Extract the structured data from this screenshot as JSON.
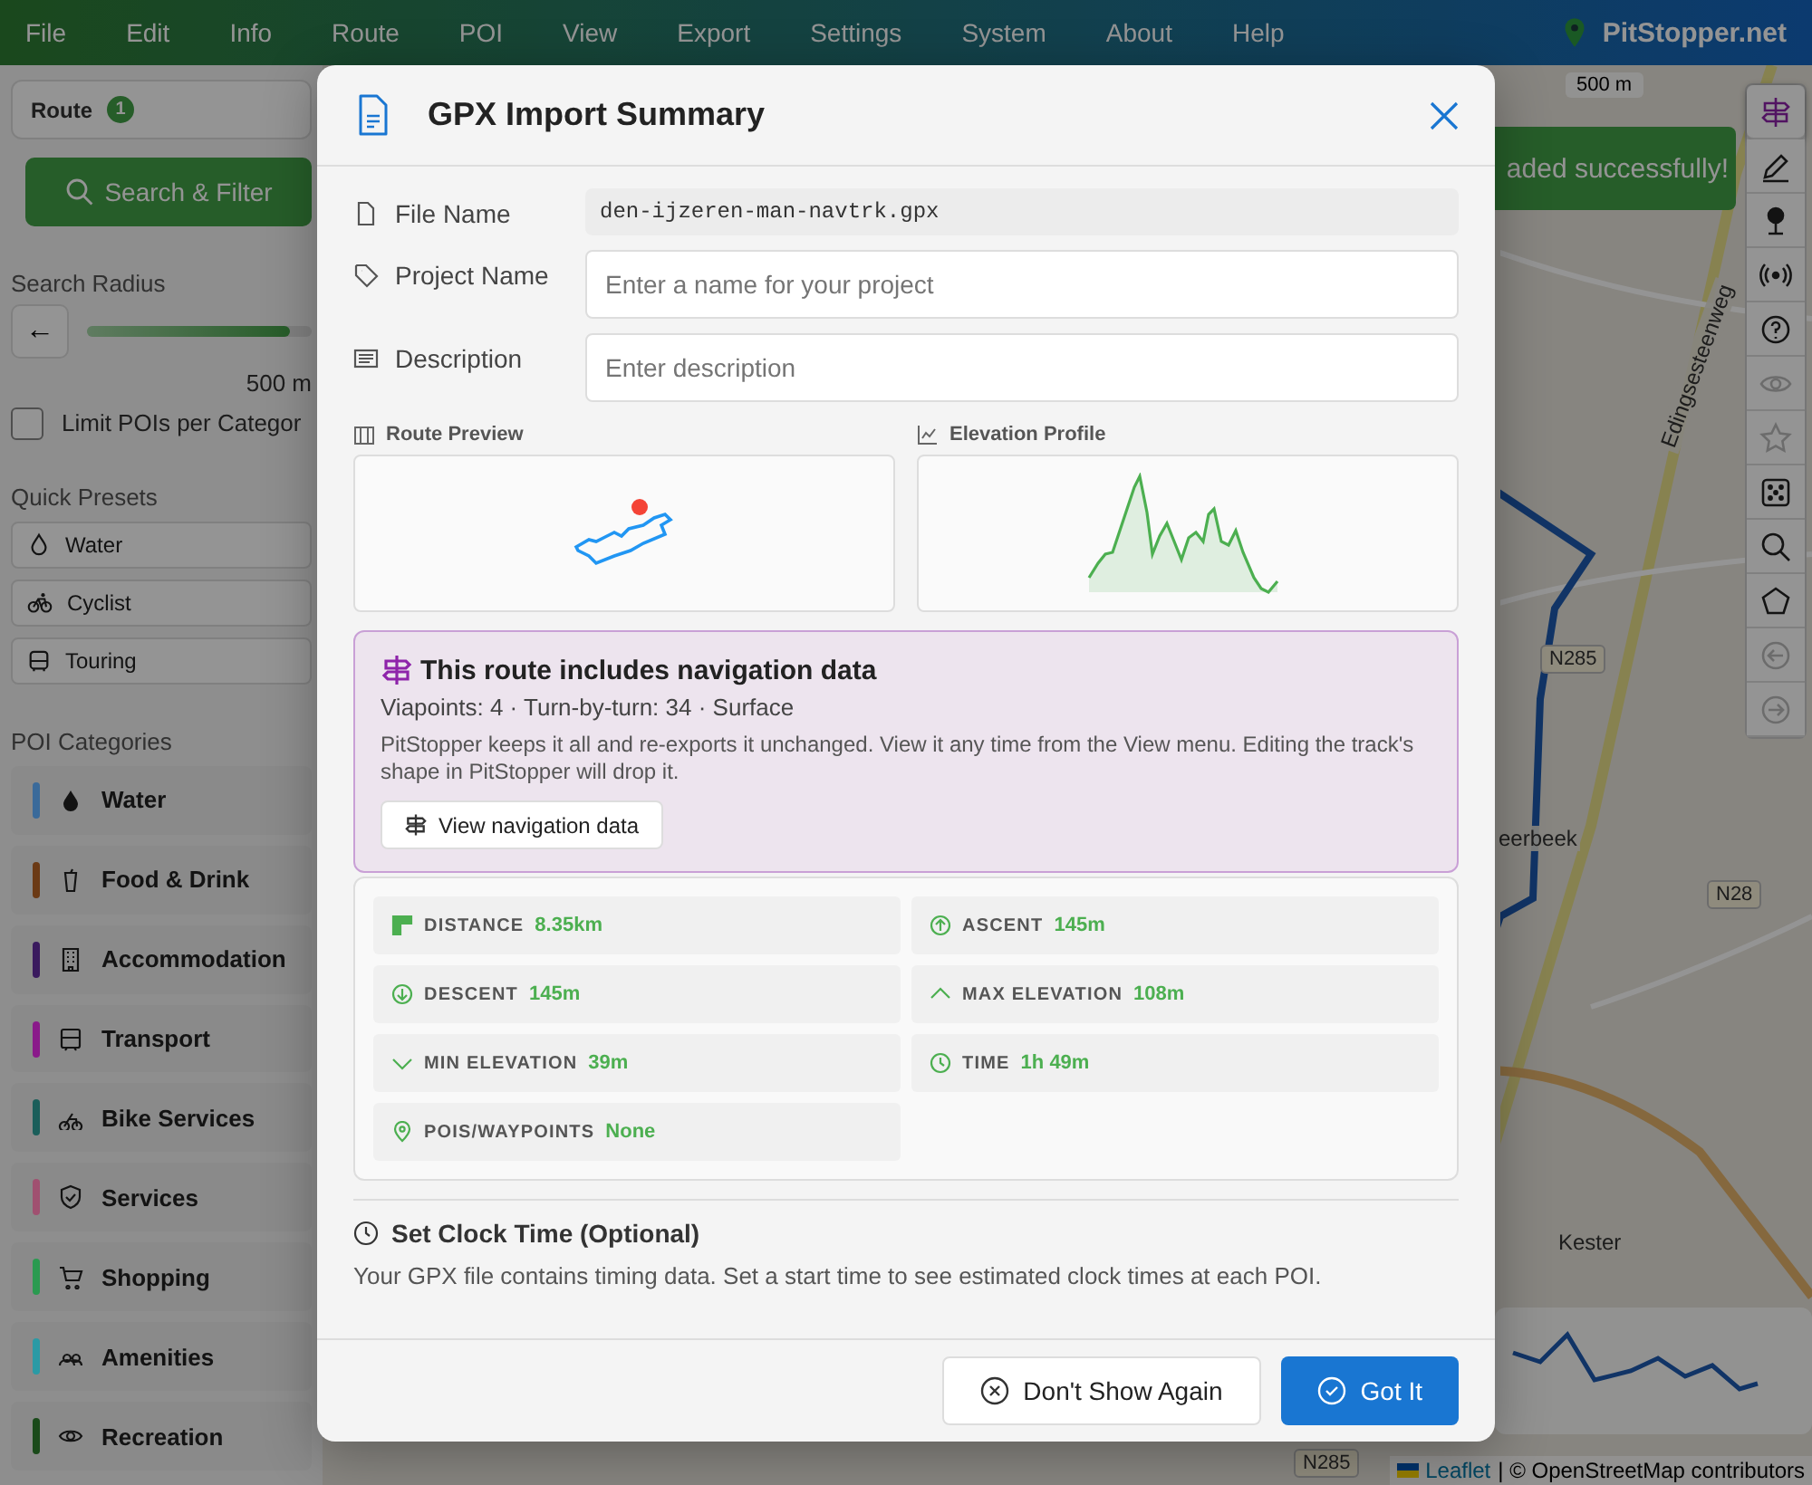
{
  "menu_bar": {
    "items": [
      "File",
      "Edit",
      "Info",
      "Route",
      "POI",
      "View",
      "Export",
      "Settings",
      "System",
      "About",
      "Help"
    ],
    "brand": "PitStopper.net"
  },
  "sidebar": {
    "route_tab": {
      "label": "Route",
      "badge": "1"
    },
    "search_button": "Search & Filter",
    "search_radius": {
      "label": "Search Radius",
      "back": "←",
      "level": 0.9,
      "reading": "500 m"
    },
    "limit_pois": {
      "label": "Limit POIs per Categor",
      "checked": false
    },
    "quick_presets": {
      "title": "Quick Presets",
      "items": [
        "Water",
        "Cyclist",
        "Touring"
      ]
    },
    "poi_categories": {
      "title": "POI Categories",
      "items": [
        {
          "label": "Water",
          "color": "#3a6a9a"
        },
        {
          "label": "Food & Drink",
          "color": "#6b3a15"
        },
        {
          "label": "Accommodation",
          "color": "#3a1a5e"
        },
        {
          "label": "Transport",
          "color": "#8a1a8a"
        },
        {
          "label": "Bike Services",
          "color": "#1a5e5a"
        },
        {
          "label": "Services",
          "color": "#a05070"
        },
        {
          "label": "Shopping",
          "color": "#2a9a50"
        },
        {
          "label": "Amenities",
          "color": "#2a9aa5"
        },
        {
          "label": "Recreation",
          "color": "#1a4a1a"
        }
      ]
    }
  },
  "map": {
    "scale": "500 m",
    "toast": "aded successfully!",
    "labels": [
      "Edingsesteenweg",
      "N285",
      "eerbeek",
      "N28",
      "Kester",
      "N285"
    ],
    "attribution": {
      "link": "Leaflet",
      "text": "| © OpenStreetMap contributors"
    },
    "tools": [
      {
        "selected": true,
        "disabled": false
      },
      {
        "selected": false,
        "disabled": false
      },
      {
        "selected": false,
        "disabled": false
      },
      {
        "selected": false,
        "disabled": false
      },
      {
        "selected": false,
        "disabled": false
      },
      {
        "selected": false,
        "disabled": true
      },
      {
        "selected": false,
        "disabled": true
      },
      {
        "selected": false,
        "disabled": false
      },
      {
        "selected": false,
        "disabled": false
      },
      {
        "selected": false,
        "disabled": false
      },
      {
        "selected": false,
        "disabled": true
      },
      {
        "selected": false,
        "disabled": true
      }
    ]
  },
  "dialog": {
    "title": "GPX Import Summary",
    "fields": [
      {
        "kind": "readonly",
        "label": "File Name",
        "value": "den-ijzeren-man-navtrk.gpx"
      },
      {
        "kind": "input",
        "label": "Project Name",
        "placeholder": "Enter a name for your project"
      },
      {
        "kind": "input",
        "label": "Description",
        "placeholder": "Enter description"
      }
    ],
    "previews": [
      {
        "title": "Route Preview"
      },
      {
        "title": "Elevation Profile"
      }
    ],
    "navigation_notice": {
      "title": "This route includes navigation data",
      "summary": "Viapoints: 4 · Turn-by-turn: 34 · Surface",
      "body": "PitStopper keeps it all and re-exports it unchanged. View it any time from the View menu. Editing the track's shape in PitStopper will drop it.",
      "button": "View navigation data"
    },
    "stats": [
      {
        "label": "DISTANCE",
        "value": "8.35km"
      },
      {
        "label": "ASCENT",
        "value": "145m"
      },
      {
        "label": "DESCENT",
        "value": "145m"
      },
      {
        "label": "MAX ELEVATION",
        "value": "108m"
      },
      {
        "label": "MIN ELEVATION",
        "value": "39m"
      },
      {
        "label": "TIME",
        "value": "1h 49m"
      },
      {
        "label": "POIS/WAYPOINTS",
        "value": "None"
      }
    ],
    "clock_section": {
      "title": "Set Clock Time (Optional)",
      "text": "Your GPX file contains timing data. Set a start time to see estimated clock times at each POI."
    },
    "buttons": [
      {
        "kind": "secondary",
        "label": "Don't Show Again"
      },
      {
        "kind": "primary",
        "label": "Got It"
      }
    ]
  }
}
